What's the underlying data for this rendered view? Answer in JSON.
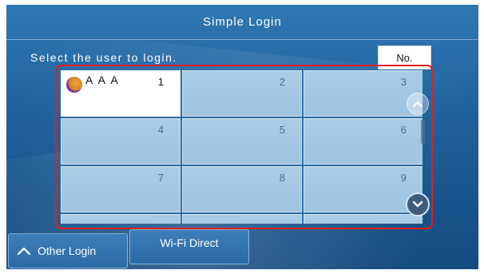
{
  "header": {
    "title": "Simple Login"
  },
  "prompt": {
    "text": "Select the user to login."
  },
  "sort_button": {
    "label": "No."
  },
  "users": [
    {
      "number": "1",
      "name": "A A A",
      "selected": true
    },
    {
      "number": "2",
      "name": ""
    },
    {
      "number": "3",
      "name": ""
    },
    {
      "number": "4",
      "name": ""
    },
    {
      "number": "5",
      "name": ""
    },
    {
      "number": "6",
      "name": ""
    },
    {
      "number": "7",
      "name": ""
    },
    {
      "number": "8",
      "name": ""
    },
    {
      "number": "9",
      "name": ""
    }
  ],
  "footer": {
    "other_login_label": "Other Login",
    "wifi_direct_label": "Wi-Fi Direct"
  },
  "icons": {
    "avatar": "user-avatar-icon",
    "scroll_up": "chevron-up-icon",
    "scroll_down": "chevron-down-icon",
    "other_login": "chevron-up-icon"
  },
  "colors": {
    "highlight_frame": "#e0201e",
    "background": "#1e5f9a",
    "selected_cell": "#ffffff",
    "cell": "#a9cce6"
  }
}
